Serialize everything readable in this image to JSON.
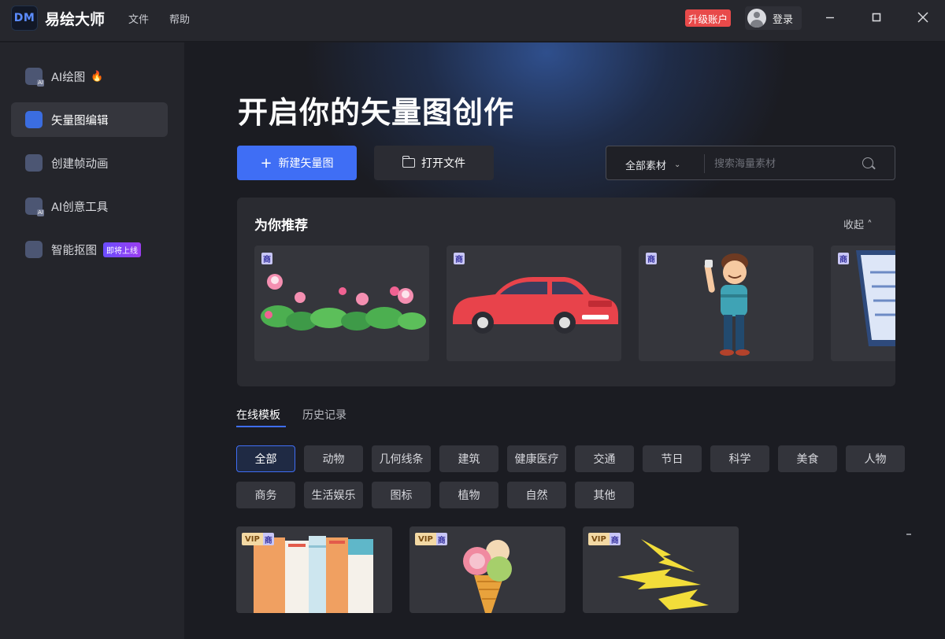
{
  "app": {
    "logo_text": "DM",
    "name": "易绘大师"
  },
  "menu": {
    "file": "文件",
    "help": "帮助"
  },
  "header": {
    "upgrade": "升级账户",
    "login": "登录"
  },
  "window_controls": {
    "minimize_icon": "minimize-icon",
    "maximize_icon": "maximize-icon",
    "close_icon": "close-icon"
  },
  "sidebar": {
    "items": [
      {
        "label": "AI绘图",
        "icon": "ai-draw-icon",
        "badge_icon": "fire-icon",
        "active": false
      },
      {
        "label": "矢量图编辑",
        "icon": "vector-edit-icon",
        "active": true
      },
      {
        "label": "创建帧动画",
        "icon": "frame-animation-icon",
        "active": false
      },
      {
        "label": "AI创意工具",
        "icon": "ai-creative-icon",
        "active": false
      },
      {
        "label": "智能抠图",
        "icon": "smart-cutout-icon",
        "badge": "即将上线",
        "active": false
      }
    ]
  },
  "hero": {
    "title": "开启你的矢量图创作",
    "new_button": "新建矢量图",
    "open_button": "打开文件",
    "search": {
      "category": "全部素材",
      "placeholder": "搜索海量素材"
    }
  },
  "recommend": {
    "title": "为你推荐",
    "collapse": "收起",
    "tag": "商",
    "cards": [
      {
        "subject": "lotus flowers"
      },
      {
        "subject": "red car"
      },
      {
        "subject": "cartoon man"
      },
      {
        "subject": "document"
      }
    ]
  },
  "tabs": {
    "online_templates": "在线模板",
    "history": "历史记录"
  },
  "categories": [
    "全部",
    "动物",
    "几何线条",
    "建筑",
    "健康医疗",
    "交通",
    "节日",
    "科学",
    "美食",
    "人物",
    "商务",
    "生活娱乐",
    "图标",
    "植物",
    "自然",
    "其他"
  ],
  "templates": {
    "vip": "VIP",
    "shang": "商",
    "cards": [
      {
        "subject": "colorful books"
      },
      {
        "subject": "ice cream cone"
      },
      {
        "subject": "lightning bolts"
      }
    ]
  },
  "colors": {
    "accent": "#3f6ef5",
    "upgrade": "#e84a4a",
    "background": "#1b1c22",
    "sidebar": "#24252b"
  }
}
